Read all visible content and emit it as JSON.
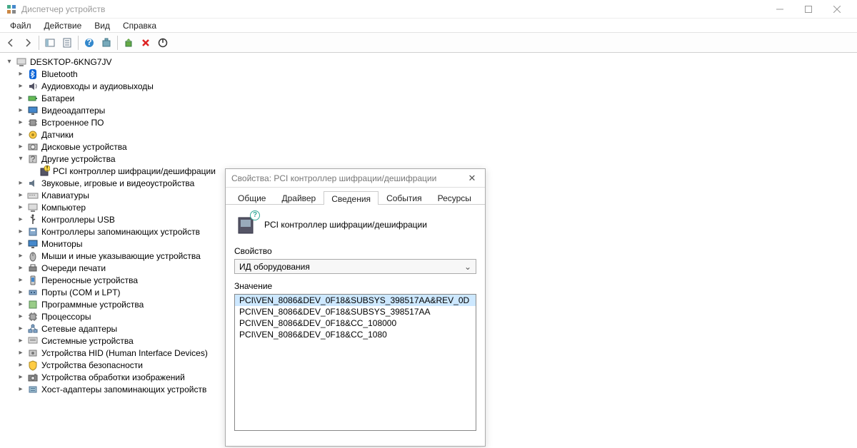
{
  "window": {
    "title": "Диспетчер устройств"
  },
  "menu": {
    "file": "Файл",
    "action": "Действие",
    "view": "Вид",
    "help": "Справка"
  },
  "tree": {
    "root": "DESKTOP-6KNG7JV",
    "items": [
      {
        "label": "Bluetooth",
        "icon": "bluetooth"
      },
      {
        "label": "Аудиовходы и аудиовыходы",
        "icon": "audio"
      },
      {
        "label": "Батареи",
        "icon": "battery"
      },
      {
        "label": "Видеоадаптеры",
        "icon": "display"
      },
      {
        "label": "Встроенное ПО",
        "icon": "chip"
      },
      {
        "label": "Датчики",
        "icon": "sensor"
      },
      {
        "label": "Дисковые устройства",
        "icon": "disk"
      },
      {
        "label": "Другие устройства",
        "icon": "other",
        "expanded": true,
        "children": [
          {
            "label": "PCI контроллер шифрации/дешифрации",
            "icon": "unknown"
          }
        ]
      },
      {
        "label": "Звуковые, игровые и видеоустройства",
        "icon": "sound"
      },
      {
        "label": "Клавиатуры",
        "icon": "keyboard"
      },
      {
        "label": "Компьютер",
        "icon": "computer"
      },
      {
        "label": "Контроллеры USB",
        "icon": "usb"
      },
      {
        "label": "Контроллеры запоминающих устройств",
        "icon": "storage"
      },
      {
        "label": "Мониторы",
        "icon": "monitor"
      },
      {
        "label": "Мыши и иные указывающие устройства",
        "icon": "mouse"
      },
      {
        "label": "Очереди печати",
        "icon": "printer"
      },
      {
        "label": "Переносные устройства",
        "icon": "portable"
      },
      {
        "label": "Порты (COM и LPT)",
        "icon": "port"
      },
      {
        "label": "Программные устройства",
        "icon": "software"
      },
      {
        "label": "Процессоры",
        "icon": "cpu"
      },
      {
        "label": "Сетевые адаптеры",
        "icon": "network"
      },
      {
        "label": "Системные устройства",
        "icon": "system"
      },
      {
        "label": "Устройства HID (Human Interface Devices)",
        "icon": "hid"
      },
      {
        "label": "Устройства безопасности",
        "icon": "security"
      },
      {
        "label": "Устройства обработки изображений",
        "icon": "imaging"
      },
      {
        "label": "Хост-адаптеры запоминающих устройств",
        "icon": "hostadapter"
      }
    ]
  },
  "dialog": {
    "title": "Свойства: PCI контроллер шифрации/дешифрации",
    "tabs": [
      "Общие",
      "Драйвер",
      "Сведения",
      "События",
      "Ресурсы"
    ],
    "active_tab": 2,
    "device_name": "PCI контроллер шифрации/дешифрации",
    "property_label": "Свойство",
    "property_value": "ИД оборудования",
    "value_label": "Значение",
    "values": [
      "PCI\\VEN_8086&DEV_0F18&SUBSYS_398517AA&REV_0D",
      "PCI\\VEN_8086&DEV_0F18&SUBSYS_398517AA",
      "PCI\\VEN_8086&DEV_0F18&CC_108000",
      "PCI\\VEN_8086&DEV_0F18&CC_1080"
    ]
  }
}
